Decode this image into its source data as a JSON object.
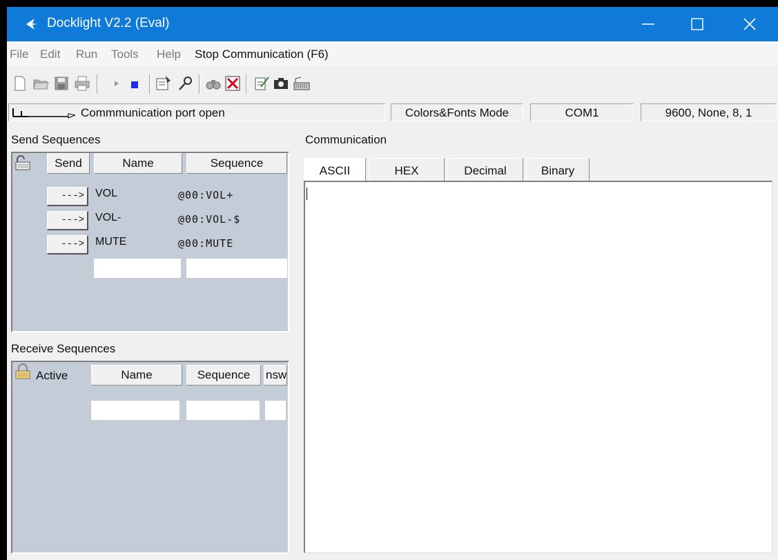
{
  "window": {
    "title": "Docklight V2.2 (Eval)"
  },
  "menu": {
    "items": [
      "File",
      "Edit",
      "Run",
      "Tools",
      "Help"
    ],
    "stop": "Stop Communication  (F6)"
  },
  "status": {
    "port_text": "Commmunication port open",
    "mode": "Colors&Fonts Mode",
    "port": "COM1",
    "settings": "9600, None, 8, 1"
  },
  "send": {
    "label": "Send Sequences",
    "headers": {
      "send": "Send",
      "name": "Name",
      "sequence": "Sequence"
    },
    "button_label": "--->",
    "rows": [
      {
        "name": "VOL",
        "sequence": "@00:VOL+"
      },
      {
        "name": "VOL-",
        "sequence": "@00:VOL-$"
      },
      {
        "name": "MUTE",
        "sequence": "@00:MUTE"
      }
    ]
  },
  "receive": {
    "label": "Receive Sequences",
    "headers": {
      "active": "Active",
      "name": "Name",
      "sequence": "Sequence",
      "answer": "nsw"
    }
  },
  "communication": {
    "label": "Communication",
    "tabs": [
      "ASCII",
      "HEX",
      "Decimal",
      "Binary"
    ],
    "active_tab": "ASCII"
  },
  "colors": {
    "titlebar": "#0f7ad8",
    "panel_bg": "#c3ccd7"
  }
}
